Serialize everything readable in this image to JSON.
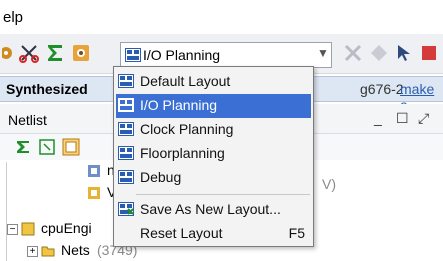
{
  "menubar": {
    "help_label": "elp"
  },
  "toolbar": {
    "layout_combo_value": "I/O Planning",
    "colors": {
      "bg": "#eef0f3"
    }
  },
  "banner": {
    "title": "Synthesized",
    "tail_text": "g676-2",
    "link_text": "make a"
  },
  "netlist_panel": {
    "title": "Netlist",
    "controls": [
      "_",
      "☐",
      "⤢"
    ]
  },
  "tree": {
    "items": [
      {
        "label": "n",
        "muted": false
      },
      {
        "label": "V",
        "muted": false
      },
      {
        "label": "V)",
        "muted": true
      },
      {
        "label": "cpuEngi",
        "muted": false
      },
      {
        "label": "Nets",
        "muted": false
      },
      {
        "label": "(3749)",
        "muted": true
      }
    ]
  },
  "dropdown": {
    "items": [
      {
        "label": "Default Layout",
        "icon": "layout-icon",
        "shortcut": ""
      },
      {
        "label": "I/O Planning",
        "icon": "layout-icon",
        "shortcut": "",
        "active": true
      },
      {
        "label": "Clock Planning",
        "icon": "layout-icon",
        "shortcut": ""
      },
      {
        "label": "Floorplanning",
        "icon": "layout-icon",
        "shortcut": ""
      },
      {
        "label": "Debug",
        "icon": "layout-icon",
        "shortcut": ""
      },
      {
        "label": "Save As New Layout...",
        "icon": "save-layout-icon",
        "shortcut": ""
      },
      {
        "label": "Reset Layout",
        "icon": "",
        "shortcut": "F5"
      }
    ],
    "colors": {
      "highlight": "#3b6fd4"
    }
  }
}
